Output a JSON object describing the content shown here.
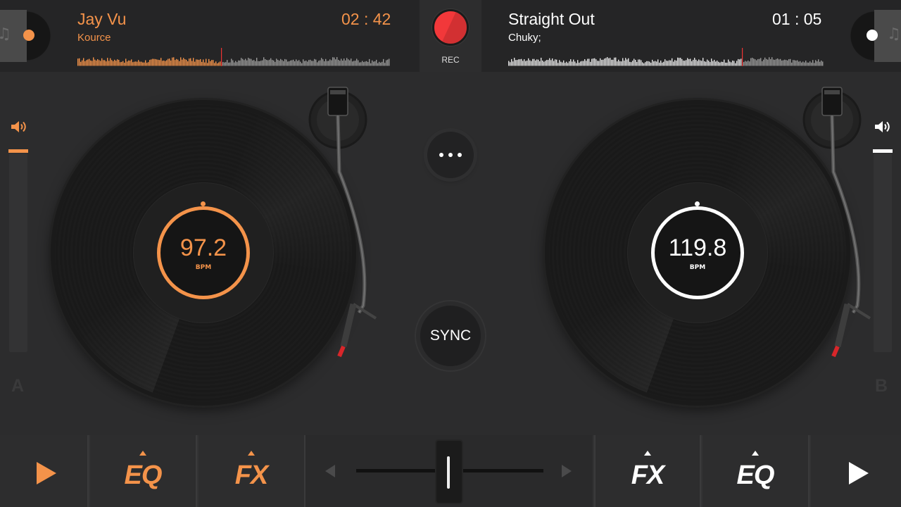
{
  "colors": {
    "deck_a_accent": "#f4934a",
    "deck_b_accent": "#ffffff",
    "rec": "#f2383a"
  },
  "deck_a": {
    "title": "Jay Vu",
    "artist": "Kource",
    "time": "02 : 42",
    "bpm": "97.2",
    "bpm_unit": "BPM",
    "letter": "A",
    "volume_level": 0.95,
    "progress": 0.46
  },
  "deck_b": {
    "title": "Straight Out",
    "artist": "Chuky;",
    "time": "01 : 05",
    "bpm": "119.8",
    "bpm_unit": "BPM",
    "letter": "B",
    "volume_level": 0.95,
    "progress": 0.74
  },
  "center": {
    "rec_label": "REC",
    "more_icon": "ellipsis-icon",
    "sync_label": "SYNC"
  },
  "bottom": {
    "eq_label": "EQ",
    "fx_label": "FX",
    "play_icon": "play-icon",
    "crossfader_position": 0.5
  }
}
